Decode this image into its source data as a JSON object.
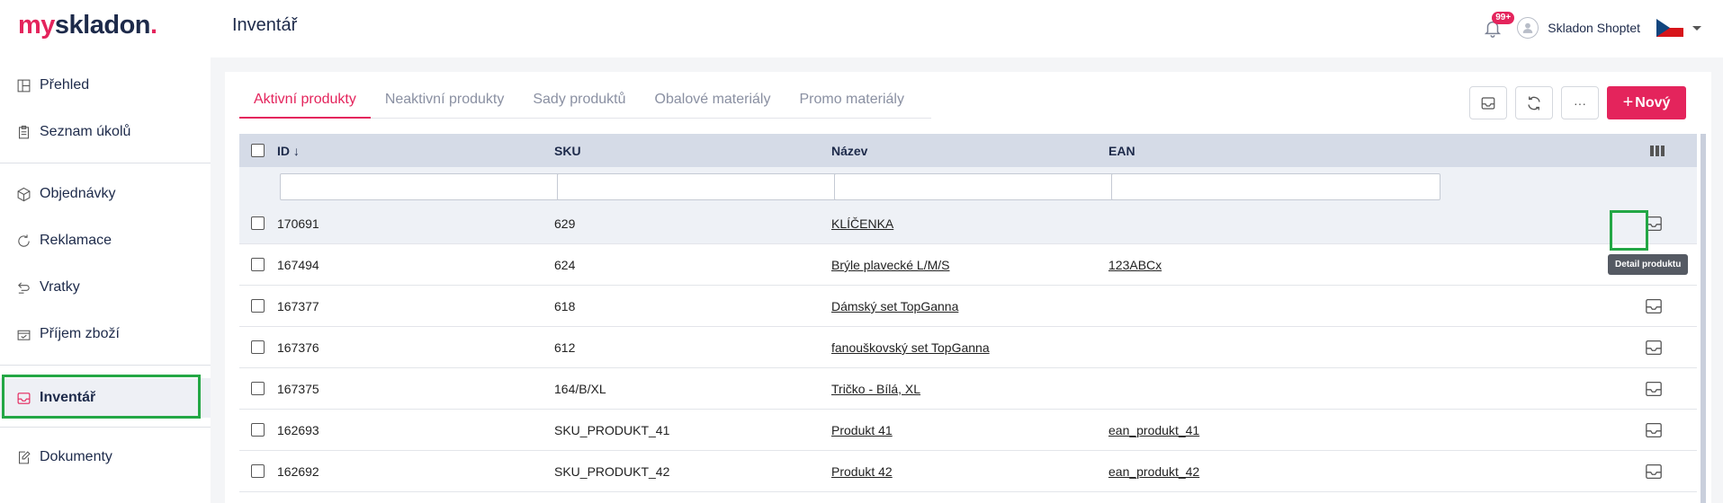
{
  "header": {
    "logo_my": "my",
    "logo_skladon": "skladon",
    "logo_dot": ".",
    "page_title": "Inventář",
    "notification_badge": "99+",
    "username": "Skladon Shoptet"
  },
  "sidebar": {
    "items": [
      {
        "label": "Přehled",
        "icon": "dashboard-icon"
      },
      {
        "label": "Seznam úkolů",
        "icon": "clipboard-icon"
      },
      {
        "label": "Objednávky",
        "icon": "box-icon"
      },
      {
        "label": "Reklamace",
        "icon": "refresh-icon"
      },
      {
        "label": "Vratky",
        "icon": "return-icon"
      },
      {
        "label": "Příjem zboží",
        "icon": "receipt-icon"
      },
      {
        "label": "Inventář",
        "icon": "inbox-icon",
        "active": true
      },
      {
        "label": "Dokumenty",
        "icon": "document-edit-icon"
      }
    ]
  },
  "tabs": [
    {
      "label": "Aktivní produkty",
      "active": true
    },
    {
      "label": "Neaktivní produkty"
    },
    {
      "label": "Sady produktů"
    },
    {
      "label": "Obalové materiály"
    },
    {
      "label": "Promo materiály"
    }
  ],
  "actions": {
    "more_label": "···",
    "new_plus": "+",
    "new_label": "Nový"
  },
  "table": {
    "columns": [
      "ID",
      "SKU",
      "Název",
      "EAN"
    ],
    "rows": [
      {
        "id": "170691",
        "sku": "629",
        "name": "KLÍČENKA",
        "ean": ""
      },
      {
        "id": "167494",
        "sku": "624",
        "name": "Brýle plavecké L/M/S",
        "ean": "123ABCx"
      },
      {
        "id": "167377",
        "sku": "618",
        "name": "Dámský set TopGanna",
        "ean": ""
      },
      {
        "id": "167376",
        "sku": "612",
        "name": "fanouškovský set TopGanna",
        "ean": ""
      },
      {
        "id": "167375",
        "sku": "164/B/XL",
        "name": "Tričko - Bílá, XL",
        "ean": ""
      },
      {
        "id": "162693",
        "sku": "SKU_PRODUKT_41",
        "name": "Produkt 41",
        "ean": "ean_produkt_41"
      },
      {
        "id": "162692",
        "sku": "SKU_PRODUKT_42",
        "name": "Produkt 42",
        "ean": "ean_produkt_42"
      }
    ]
  },
  "tooltip": "Detail produktu",
  "colors": {
    "brand": "#e4245c",
    "navy": "#1d2a4a",
    "highlight": "#23a745"
  }
}
